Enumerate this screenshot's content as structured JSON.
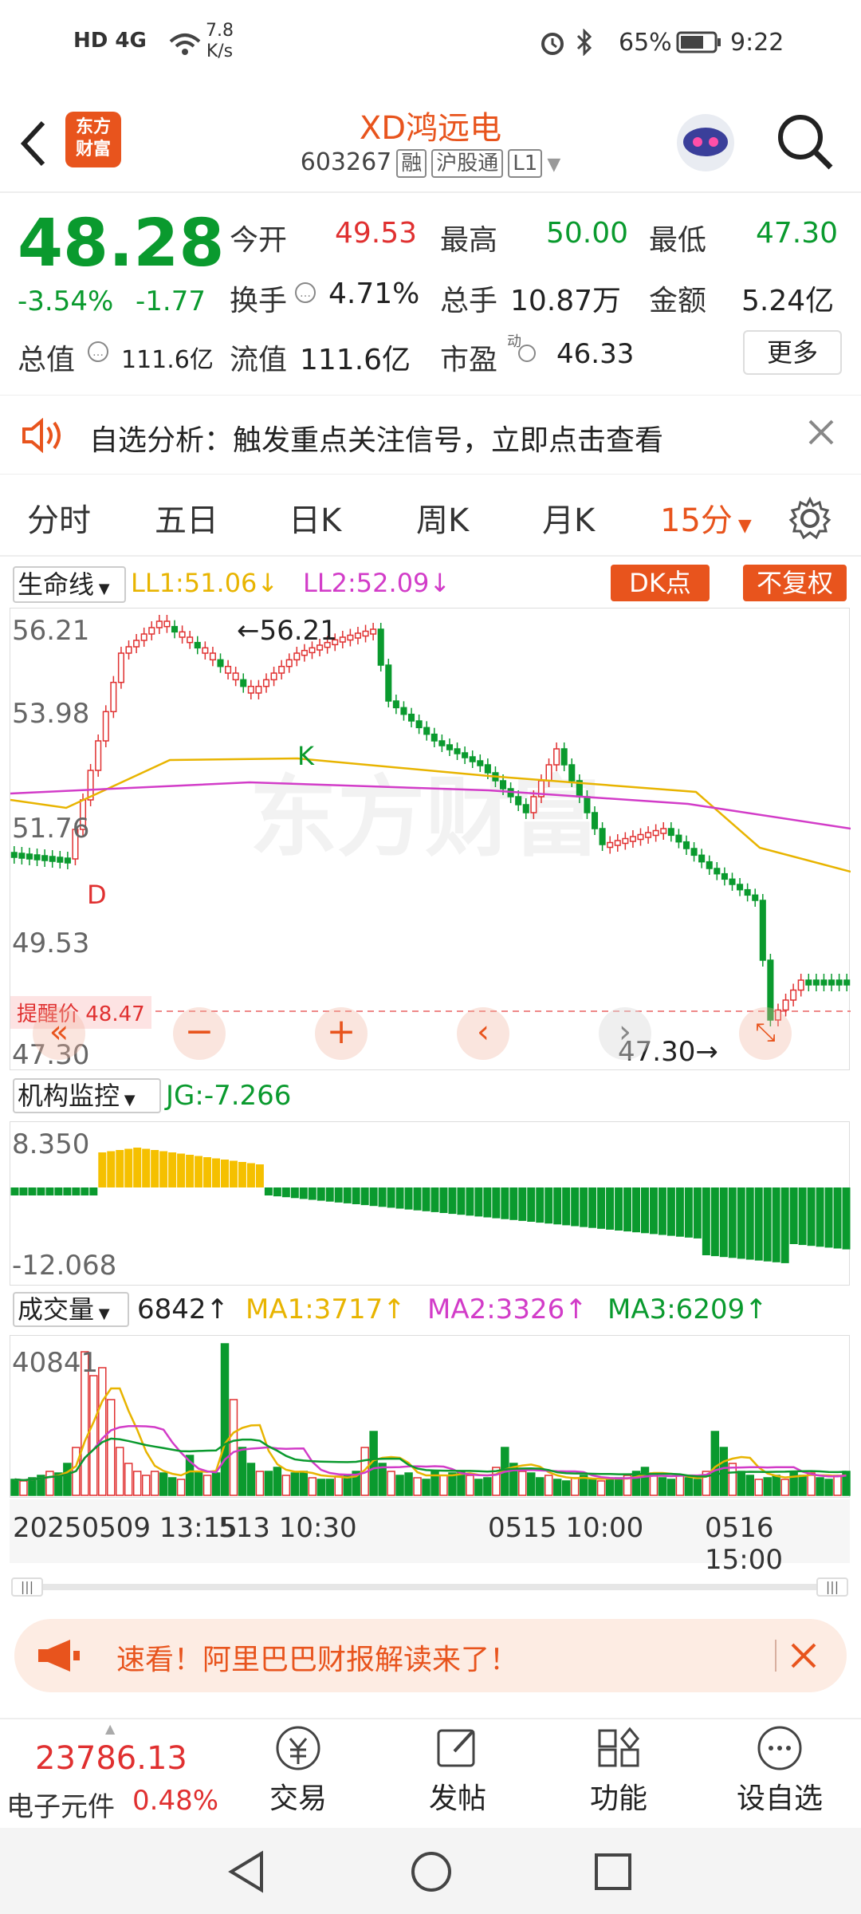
{
  "status": {
    "left": "HD 4G",
    "speed_value": "7.8",
    "speed_unit": "K/s",
    "battery": "65%",
    "time": "9:22"
  },
  "header": {
    "title": "XD鸿远电",
    "logo_text_1": "东方",
    "logo_text_2": "财富",
    "code": "603267",
    "tag_rong": "融",
    "tag_hgt": "沪股通",
    "tag_level": "L1"
  },
  "quote": {
    "price": "48.28",
    "change_pct": "-3.54%",
    "change_val": "-1.77",
    "open_label": "今开",
    "open": "49.53",
    "high_label": "最高",
    "high": "50.00",
    "low_label": "最低",
    "low": "47.30",
    "turnover_label": "换手",
    "turnover": "4.71%",
    "volume_label": "总手",
    "volume": "10.87万",
    "amount_label": "金额",
    "amount": "5.24亿",
    "mktcap_label": "总值",
    "mktcap": "111.6亿",
    "float_label": "流值",
    "float": "111.6亿",
    "pe_label": "市盈",
    "pe_sup": "动",
    "pe": "46.33",
    "more_label": "更多"
  },
  "banner": {
    "text": "自选分析：触发重点关注信号，立即点击查看"
  },
  "tabs": [
    {
      "label": "分时"
    },
    {
      "label": "五日"
    },
    {
      "label": "日K"
    },
    {
      "label": "周K"
    },
    {
      "label": "月K"
    },
    {
      "label": "15分"
    }
  ],
  "main_chart": {
    "indicator_label": "生命线",
    "ll1": "LL1:51.06↓",
    "ll2": "LL2:52.09↓",
    "dk_label": "DK点",
    "fq_label": "不复权",
    "y_ticks": [
      "56.21",
      "53.98",
      "51.76",
      "49.53",
      "47.30"
    ],
    "max_marker": "←56.21",
    "min_marker": "47.30→",
    "alert_label": "提醒价 48.47",
    "d_marker": "D",
    "k_marker": "K",
    "watermark": "东方财富"
  },
  "jg_chart": {
    "label": "机构监控",
    "value": "JG:-7.266",
    "y_max": "8.350",
    "y_min": "-12.068"
  },
  "vol_chart": {
    "label": "成交量",
    "current": "6842↑",
    "ma1": "MA1:3717↑",
    "ma2": "MA2:3326↑",
    "ma3": "MA3:6209↑",
    "y_max": "40841",
    "x_labels": [
      "20250509 13:15",
      "513 10:30",
      "0515 10:00",
      "0516 15:00"
    ]
  },
  "news": {
    "text": "速看！阿里巴巴财报解读来了！"
  },
  "bottom": {
    "index_value": "23786.13",
    "index_name": "电子元件",
    "index_pct": "0.48%",
    "nav": [
      {
        "label": "交易"
      },
      {
        "label": "发帖"
      },
      {
        "label": "功能"
      },
      {
        "label": "设自选"
      }
    ]
  },
  "colors": {
    "up": "#e03030",
    "down": "#0a9a2e",
    "accent": "#e8541d",
    "ll1": "#e8b400",
    "ll2": "#d23cc8",
    "jg_up": "#f5c000"
  }
}
